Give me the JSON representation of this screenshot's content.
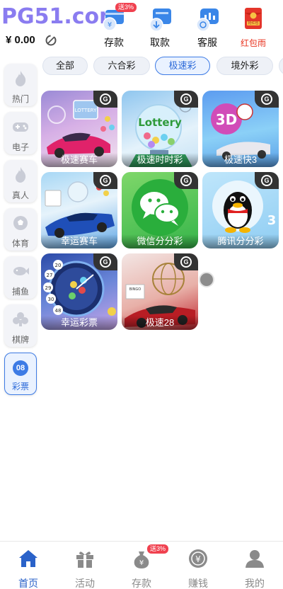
{
  "header": {
    "logo": "PG51.com",
    "balance": "¥ 0.00",
    "buttons": [
      {
        "label": "存款",
        "badge": "送3%"
      },
      {
        "label": "取款"
      },
      {
        "label": "客服"
      },
      {
        "label": "红包雨",
        "icon_text": "抢红包"
      }
    ]
  },
  "tabs": [
    "全部",
    "六合彩",
    "极速彩",
    "境外彩"
  ],
  "active_tab": "极速彩",
  "sidebar": [
    {
      "label": "热门"
    },
    {
      "label": "电子"
    },
    {
      "label": "真人"
    },
    {
      "label": "体育"
    },
    {
      "label": "捕鱼"
    },
    {
      "label": "棋牌"
    },
    {
      "label": "彩票",
      "number": "08"
    }
  ],
  "games": [
    {
      "label": "极速赛车",
      "art_text": "LOTTERY"
    },
    {
      "label": "极速时时彩",
      "art_text": "Lottery"
    },
    {
      "label": "极速快3",
      "art_text": "3D"
    },
    {
      "label": "幸运赛车"
    },
    {
      "label": "微信分分彩"
    },
    {
      "label": "腾讯分分彩",
      "art_text": "3"
    },
    {
      "label": "幸运彩票",
      "balls": [
        "20",
        "27",
        "29",
        "30",
        "48"
      ]
    },
    {
      "label": "极速28",
      "art_text": "BINGO"
    }
  ],
  "bottom_nav": [
    {
      "label": "首页"
    },
    {
      "label": "活动"
    },
    {
      "label": "存款",
      "badge": "送3%"
    },
    {
      "label": "赚钱",
      "icon_text": "¥"
    },
    {
      "label": "我的"
    }
  ],
  "colors": {
    "accent": "#3d7be5",
    "logo": "#8a7cf0",
    "red": "#e8321e"
  }
}
